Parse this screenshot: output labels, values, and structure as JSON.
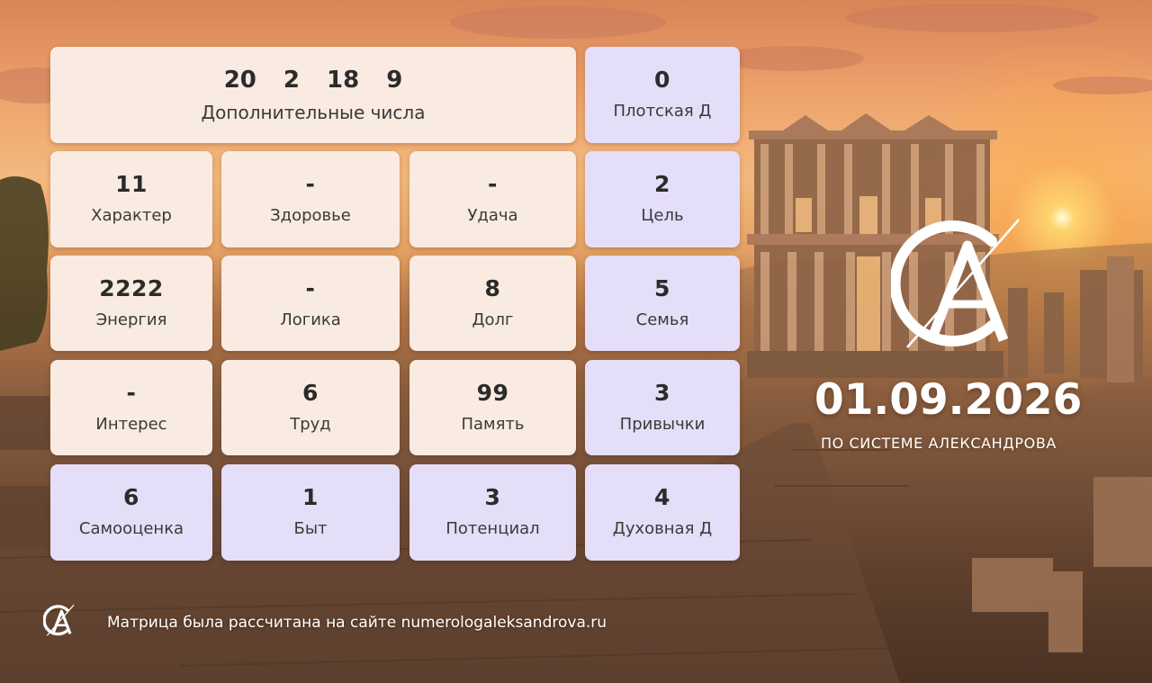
{
  "extra": {
    "numbers": [
      "20",
      "2",
      "18",
      "9"
    ],
    "label": "Дополнительные числа"
  },
  "cards": {
    "plotskaya": {
      "value": "0",
      "label": "Плотская Д"
    },
    "harakter": {
      "value": "11",
      "label": "Характер"
    },
    "zdorovye": {
      "value": "-",
      "label": "Здоровье"
    },
    "udacha": {
      "value": "-",
      "label": "Удача"
    },
    "tsel": {
      "value": "2",
      "label": "Цель"
    },
    "energiya": {
      "value": "2222",
      "label": "Энергия"
    },
    "logika": {
      "value": "-",
      "label": "Логика"
    },
    "dolg": {
      "value": "8",
      "label": "Долг"
    },
    "semya": {
      "value": "5",
      "label": "Семья"
    },
    "interes": {
      "value": "-",
      "label": "Интерес"
    },
    "trud": {
      "value": "6",
      "label": "Труд"
    },
    "pamyat": {
      "value": "99",
      "label": "Память"
    },
    "privychki": {
      "value": "3",
      "label": "Привычки"
    },
    "samootsenka": {
      "value": "6",
      "label": "Самооценка"
    },
    "byt": {
      "value": "1",
      "label": "Быт"
    },
    "potentsial": {
      "value": "3",
      "label": "Потенциал"
    },
    "duhovnaya": {
      "value": "4",
      "label": "Духовная Д"
    }
  },
  "brand": {
    "date": "01.09.2026",
    "subtitle": "ПО СИСТЕМЕ АЛЕКСАНДРОВА",
    "logo_icon": "ca-monogram-icon"
  },
  "footer": {
    "text": "Матрица была рассчитана на сайте numerologaleksandrova.ru",
    "logo_icon": "ca-monogram-icon"
  },
  "colors": {
    "card_beige": "#f9ebe1",
    "card_purple": "#e5def8",
    "text_dark": "#2b2b2b",
    "brand_white": "#ffffff"
  }
}
